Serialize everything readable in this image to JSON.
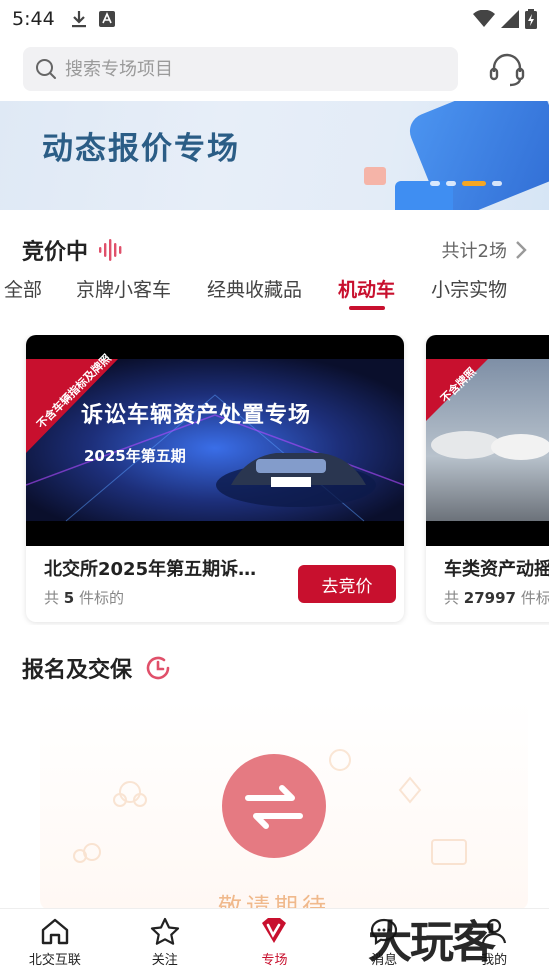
{
  "status_bar": {
    "time": "5:44"
  },
  "search": {
    "placeholder": "搜索专场项目"
  },
  "banner": {
    "title": "动态报价专场"
  },
  "bidding": {
    "title": "竞价中",
    "total": "共计2场"
  },
  "tabs": [
    {
      "label": "全部"
    },
    {
      "label": "京牌小客车"
    },
    {
      "label": "经典收藏品"
    },
    {
      "label": "机动车",
      "active": true
    },
    {
      "label": "小宗实物"
    }
  ],
  "cards": [
    {
      "ribbon": "不含车辆指标及牌照",
      "poster_title": "诉讼车辆资产处置专场",
      "poster_sub": "2025年第五期",
      "title": "北交所2025年第五期诉…",
      "meta_prefix": "共",
      "count": "5",
      "meta_suffix": "件标的",
      "button": "去竞价"
    },
    {
      "ribbon": "不含牌照",
      "title": "车类资产动摇",
      "meta_prefix": "共",
      "count": "27997",
      "meta_suffix": "件标"
    }
  ],
  "signup": {
    "title": "报名及交保",
    "coming": "敬请期待"
  },
  "nav": [
    {
      "label": "北交互联",
      "icon": "home-icon"
    },
    {
      "label": "关注",
      "icon": "star-icon"
    },
    {
      "label": "专场",
      "icon": "v-diamond-icon",
      "active": true
    },
    {
      "label": "消息",
      "icon": "message-icon"
    },
    {
      "label": "我的",
      "icon": "user-icon"
    }
  ],
  "watermark": "大玩客",
  "colors": {
    "accent": "#c8102e",
    "banner_text": "#2b5d86"
  }
}
